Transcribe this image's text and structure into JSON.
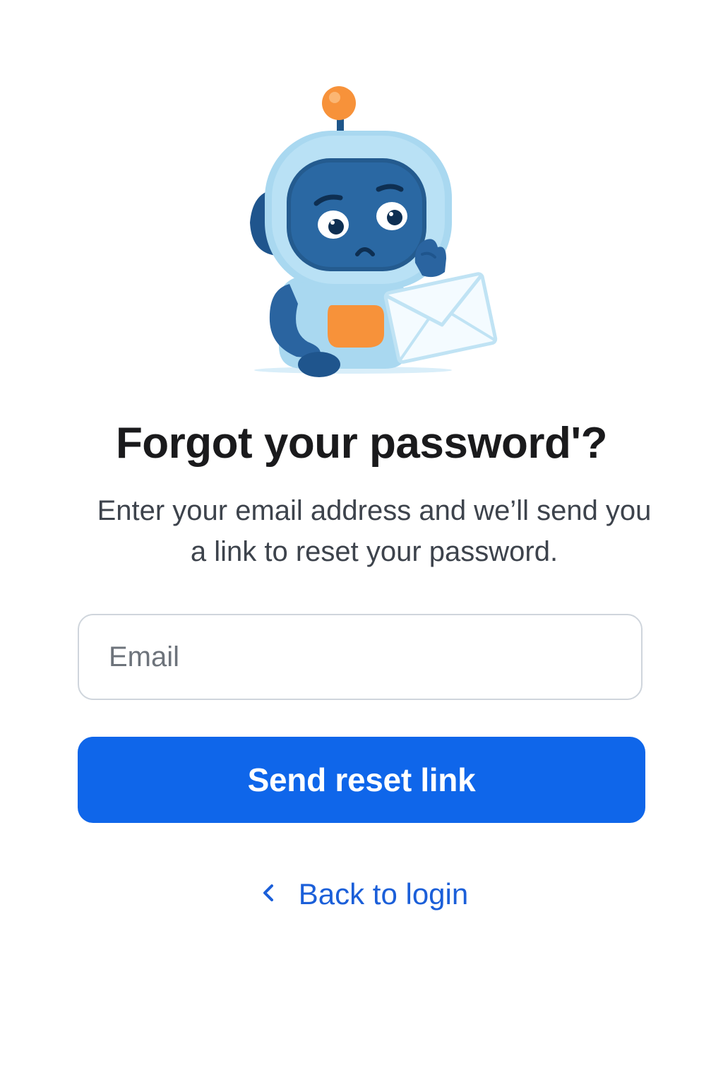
{
  "illustration": {
    "name": "confused-robot-with-envelope",
    "colors": {
      "shell": "#a9d8f0",
      "face": "#245b8f",
      "accent": "#f7923a",
      "envelope": "#f4fbff"
    }
  },
  "header": {
    "title": "Forgot your password'?",
    "subtitle": "Enter your email address and we’ll send you a link to reset your password."
  },
  "form": {
    "email": {
      "value": "",
      "placeholder": "Email"
    },
    "submit_label": "Send reset link"
  },
  "footer": {
    "back_icon": "chevron-left-icon",
    "back_label": "Back to login"
  },
  "colors": {
    "primary": "#0f66ea",
    "link": "#1b5fd9",
    "title": "#1a1a1c",
    "body_text": "#3d434c",
    "input_border": "#cfd5dc"
  }
}
